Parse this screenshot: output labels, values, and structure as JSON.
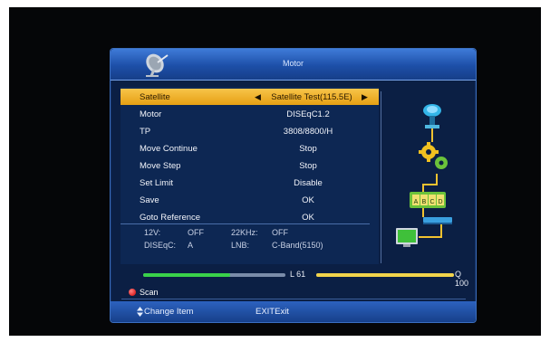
{
  "window": {
    "title": "Motor"
  },
  "menu": {
    "items": [
      {
        "label": "Satellite",
        "value": "Satellite Test(115.5E)",
        "selected": true
      },
      {
        "label": "Motor",
        "value": "DISEqC1.2"
      },
      {
        "label": "TP",
        "value": "3808/8800/H"
      },
      {
        "label": "Move Continue",
        "value": "Stop"
      },
      {
        "label": "Move Step",
        "value": "Stop"
      },
      {
        "label": "Set Limit",
        "value": "Disable"
      },
      {
        "label": "Save",
        "value": "OK"
      },
      {
        "label": "Goto Reference",
        "value": "OK"
      }
    ]
  },
  "info": {
    "v12_label": "12V:",
    "v12_value": "OFF",
    "khz_label": "22KHz:",
    "khz_value": "OFF",
    "diseqc_label": "DISEqC:",
    "diseqc_value": "A",
    "lnb_label": "LNB:",
    "lnb_value": "C-Band(5150)"
  },
  "diagram": {
    "port_letters": [
      "A",
      "B",
      "C",
      "D"
    ]
  },
  "signal": {
    "level_label": "L 61",
    "quality_label": "Q 100",
    "level_pct": 61,
    "quality_pct": 100
  },
  "scan": {
    "label": "Scan"
  },
  "footer": {
    "change_item": "Change Item",
    "exit": "EXITExit"
  },
  "colors": {
    "accent_yellow": "#f3b22e",
    "level_green": "#39d24a",
    "quality_yellow": "#f2d44b"
  }
}
